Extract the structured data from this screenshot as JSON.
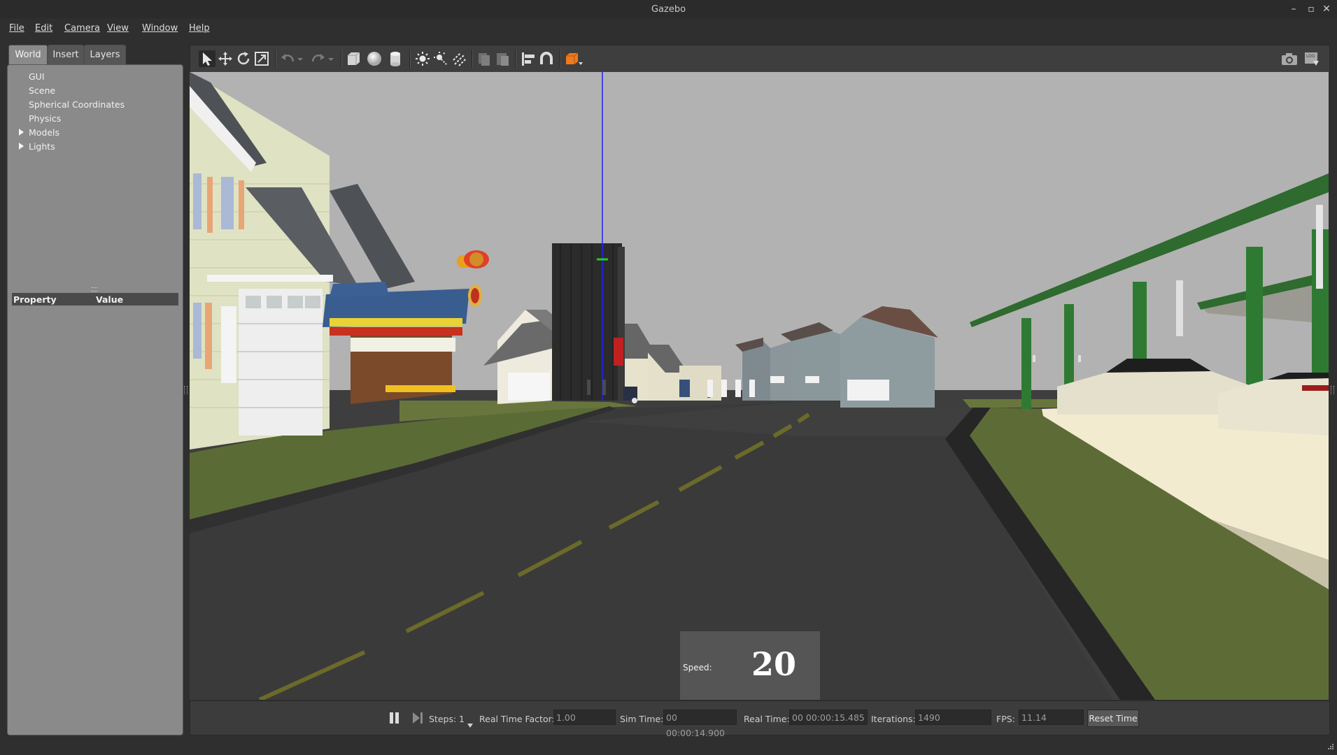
{
  "window": {
    "title": "Gazebo"
  },
  "menu": [
    "File",
    "Edit",
    "Camera",
    "View",
    "Window",
    "Help"
  ],
  "left_panel": {
    "tabs": [
      "World",
      "Insert",
      "Layers"
    ],
    "tree": [
      "GUI",
      "Scene",
      "Spherical Coordinates",
      "Physics",
      "Models",
      "Lights"
    ],
    "property_header": [
      "Property",
      "Value"
    ]
  },
  "toolbar": {
    "icons": [
      "select-arrow-icon",
      "translate-icon",
      "rotate-icon",
      "scale-icon",
      "undo-icon",
      "redo-icon",
      "box-shape-icon",
      "sphere-shape-icon",
      "cylinder-shape-icon",
      "point-light-icon",
      "spot-light-icon",
      "directional-light-icon",
      "copy-icon",
      "paste-icon",
      "align-icon",
      "snap-icon",
      "view-angle-icon",
      "screenshot-icon",
      "log-icon"
    ]
  },
  "overlay": {
    "speed_label": "Speed:",
    "speed_value": "20"
  },
  "bottom_bar": {
    "steps_label": "Steps:",
    "steps_value": "1",
    "rtf_label": "Real Time Factor:",
    "rtf_value": "1.00",
    "sim_time_label": "Sim Time:",
    "sim_time_value": "00 00:00:14.900",
    "real_time_label": "Real Time:",
    "real_time_value": "00 00:00:15.485",
    "iterations_label": "Iterations:",
    "iterations_value": "1490",
    "fps_label": "FPS:",
    "fps_value": "11.14",
    "reset_label": "Reset Time"
  }
}
